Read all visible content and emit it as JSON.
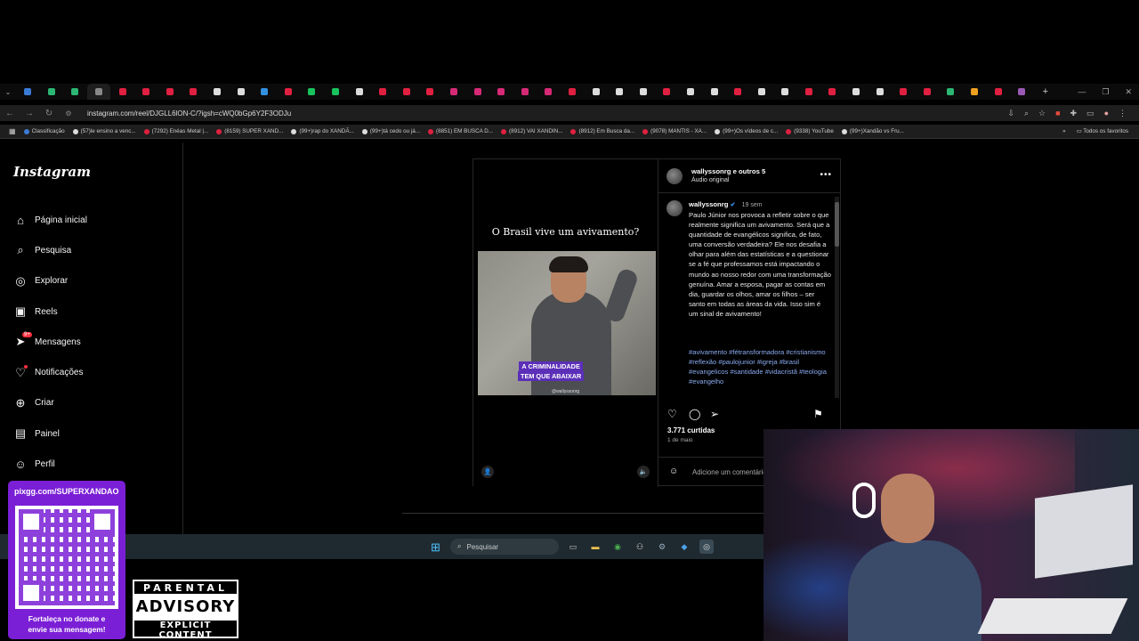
{
  "browser": {
    "url": "instagram.com/reel/DJGLL6lON-C/?igsh=cWQ0bGp6Y2F3ODJu",
    "tab_colors": [
      "#3a7bd5",
      "#2bb673",
      "#2bb673",
      "#888",
      "#e02040",
      "#e02040",
      "#e02040",
      "#e02040",
      "#ddd",
      "#ddd",
      "#3390e0",
      "#e02040",
      "#19c35c",
      "#19c35c",
      "#ddd",
      "#e02040",
      "#e02040",
      "#e02040",
      "#d62976",
      "#d62976",
      "#d62976",
      "#d62976",
      "#d62976",
      "#e02040",
      "#ddd",
      "#ddd",
      "#ddd",
      "#e02040",
      "#ddd",
      "#ddd",
      "#e02040",
      "#ddd",
      "#ddd",
      "#e02040",
      "#e02040",
      "#ddd",
      "#ddd",
      "#e02040",
      "#e02040",
      "#2bb673",
      "#f0a020",
      "#e02040",
      "#9b59b6"
    ],
    "bookmarks": [
      {
        "label": "Classificação",
        "color": "#3a7bd5"
      },
      {
        "label": "(57)le ensino a venc...",
        "color": "#ddd"
      },
      {
        "label": "(7292) Enéas Metal |...",
        "color": "#e02040"
      },
      {
        "label": "(8159) SUPER XAND...",
        "color": "#e02040"
      },
      {
        "label": "(99+)rap do XANDÃ...",
        "color": "#ddd"
      },
      {
        "label": "(99+)tá cedo ou já...",
        "color": "#ddd"
      },
      {
        "label": "(8851) EM BUSCA D...",
        "color": "#e02040"
      },
      {
        "label": "(8912) VAI XANDIN...",
        "color": "#e02040"
      },
      {
        "label": "(8912) Em Busca da...",
        "color": "#e02040"
      },
      {
        "label": "(9078) MANTIS - XA...",
        "color": "#e02040"
      },
      {
        "label": "(99+)Os vídeos de c...",
        "color": "#ddd"
      },
      {
        "label": "(9338) YouTube",
        "color": "#e02040"
      },
      {
        "label": "(99+)Xandão vs Fru...",
        "color": "#ddd"
      }
    ],
    "bookmarks_all": "Todos os favoritos"
  },
  "sidebar": {
    "logo": "Instagram",
    "items": [
      {
        "label": "Página inicial",
        "icon": "home-icon"
      },
      {
        "label": "Pesquisa",
        "icon": "search-icon"
      },
      {
        "label": "Explorar",
        "icon": "compass-icon"
      },
      {
        "label": "Reels",
        "icon": "reels-icon"
      },
      {
        "label": "Mensagens",
        "icon": "messenger-icon",
        "badge": "9+"
      },
      {
        "label": "Notificações",
        "icon": "heart-icon"
      },
      {
        "label": "Criar",
        "icon": "plus-icon"
      },
      {
        "label": "Painel",
        "icon": "chart-icon"
      },
      {
        "label": "Perfil",
        "icon": "profile-icon"
      }
    ]
  },
  "post": {
    "video_title": "O Brasil vive um avivamento?",
    "video_caption_line1": "A CRIMINALIDADE",
    "video_caption_line2": "TEM QUE ABAIXAR",
    "video_watermark": "@wallyssonrg",
    "header_user": "wallyssonrg e outros 5",
    "header_audio": "Áudio original",
    "comment_user": "wallyssonrg",
    "comment_time": "19 sem",
    "comment_text": "Paulo Júnior nos provoca a refletir sobre o que realmente significa um avivamento. Será que a quantidade de evangélicos significa, de fato, uma conversão verdadeira? Ele nos desafia a olhar para além das estatísticas e a questionar se a fé que professamos está impactando o mundo ao nosso redor com uma transformação genuína. Amar a esposa, pagar as contas em dia, guardar os olhos, amar os filhos – ser santo em todas as áreas da vida. Isso sim é um sinal de avivamento!",
    "hashtags": "#avivamento #fétransformadora #cristianismo #reflexão #paulojunior #igreja #brasil #evangelicos #santidade #vidacristã #teologia #evangelho",
    "likes": "3.771 curtidas",
    "date": "1 de maio",
    "comment_placeholder": "Adicione um comentário..."
  },
  "taskbar": {
    "search_label": "Pesquisar"
  },
  "overlay": {
    "donate_url": "pixgg.com/SUPERXANDAO",
    "donate_msg_line1": "Fortaleça no donate e",
    "donate_msg_line2": "envie sua mensagem!",
    "advisory_line1": "PARENTAL",
    "advisory_line2": "ADVISORY",
    "advisory_line3": "EXPLICIT CONTENT"
  }
}
